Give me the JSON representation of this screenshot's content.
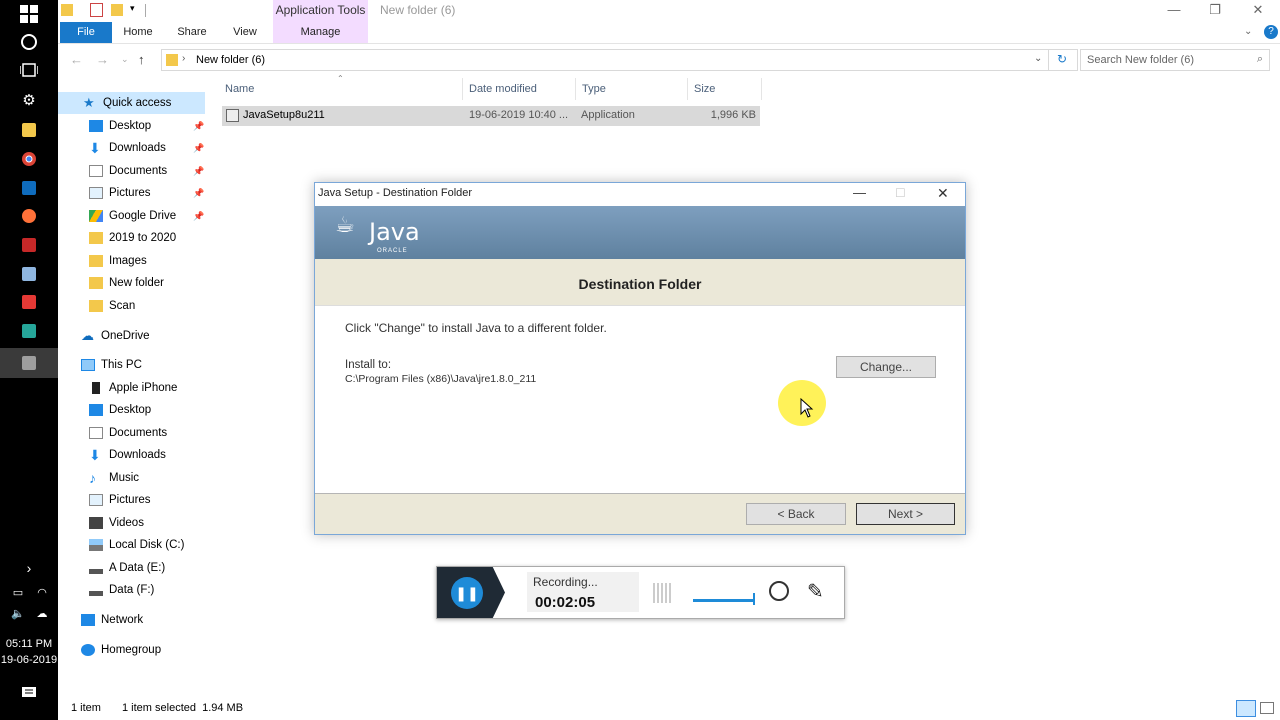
{
  "taskbar": {
    "clock_time": "05:11 PM",
    "clock_date": "19-06-2019"
  },
  "ribbon": {
    "contextual_tab": "Application Tools",
    "window_title": "New folder (6)",
    "tabs": [
      "File",
      "Home",
      "Share",
      "View",
      "Manage"
    ]
  },
  "address_bar": {
    "path": "New folder (6)",
    "search_placeholder": "Search New folder (6)"
  },
  "sidebar": {
    "quick_access": "Quick access",
    "quick_items": [
      {
        "label": "Desktop",
        "pinned": true
      },
      {
        "label": "Downloads",
        "pinned": true
      },
      {
        "label": "Documents",
        "pinned": true
      },
      {
        "label": "Pictures",
        "pinned": true
      },
      {
        "label": "Google Drive",
        "pinned": true
      },
      {
        "label": "2019 to 2020",
        "pinned": false
      },
      {
        "label": "Images",
        "pinned": false
      },
      {
        "label": "New folder",
        "pinned": false
      },
      {
        "label": "Scan",
        "pinned": false
      }
    ],
    "onedrive": "OneDrive",
    "this_pc": "This PC",
    "pc_items": [
      "Apple iPhone",
      "Desktop",
      "Documents",
      "Downloads",
      "Music",
      "Pictures",
      "Videos",
      "Local Disk (C:)",
      "A Data (E:)",
      "Data (F:)"
    ],
    "network": "Network",
    "homegroup": "Homegroup"
  },
  "file_list": {
    "columns": [
      "Name",
      "Date modified",
      "Type",
      "Size"
    ],
    "rows": [
      {
        "name": "JavaSetup8u211",
        "date": "19-06-2019 10:40 ...",
        "type": "Application",
        "size": "1,996 KB"
      }
    ]
  },
  "status_bar": {
    "item_count": "1 item",
    "selection": "1 item selected  1.94 MB"
  },
  "dialog": {
    "title": "Java Setup - Destination Folder",
    "logo_text": "Java",
    "logo_sub": "ORACLE",
    "heading": "Destination Folder",
    "instruction": "Click \"Change\" to install Java to a different folder.",
    "install_to_label": "Install to:",
    "install_path": "C:\\Program Files (x86)\\Java\\jre1.8.0_211",
    "change_button": "Change...",
    "back_button": "< Back",
    "next_button": "Next >"
  },
  "recorder": {
    "status": "Recording...",
    "elapsed": "00:02:05"
  },
  "colors": {
    "file_tab": "#1979ca",
    "contextual_tab": "#f3dcff",
    "dialog_banner": "#6e90b0",
    "dialog_header": "#ebe8d8",
    "recorder_button": "#1e8bd8",
    "cursor_highlight": "#fff03c"
  }
}
